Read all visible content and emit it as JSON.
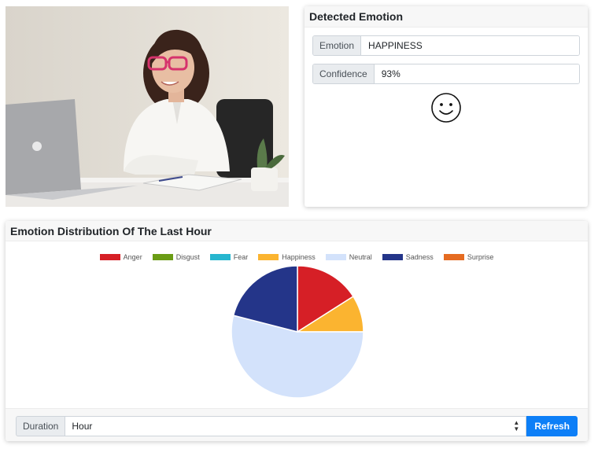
{
  "detected": {
    "title": "Detected Emotion",
    "emotion_label": "Emotion",
    "emotion_value": "HAPPINESS",
    "confidence_label": "Confidence",
    "confidence_value": "93%",
    "icon": "smiley-icon"
  },
  "distribution": {
    "title": "Emotion Distribution Of The Last Hour",
    "duration_label": "Duration",
    "duration_value": "Hour",
    "refresh_label": "Refresh"
  },
  "chart_data": {
    "type": "pie",
    "categories": [
      "Anger",
      "Disgust",
      "Fear",
      "Happiness",
      "Neutral",
      "Sadness",
      "Surprise"
    ],
    "values": [
      16,
      0,
      0,
      9,
      54,
      21,
      0
    ],
    "colors": [
      "#d61f26",
      "#6a9c15",
      "#27b6cf",
      "#fbb430",
      "#d3e2fb",
      "#243589",
      "#e56b21"
    ],
    "legend": "top"
  },
  "colors": {
    "accent": "#0d7ff7",
    "header_bg": "#f7f7f7"
  }
}
